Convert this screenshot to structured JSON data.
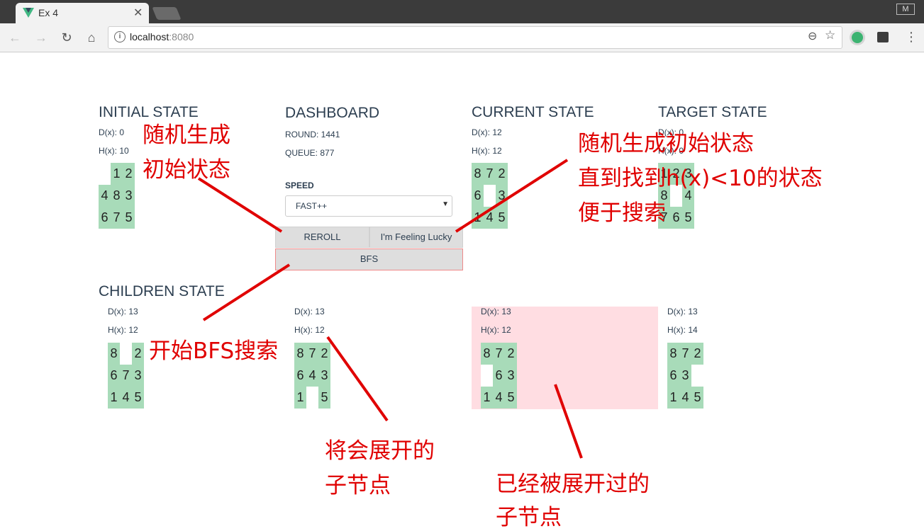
{
  "browser": {
    "tab_title": "Ex 4",
    "tab_close": "✕",
    "profile_letter": "M",
    "url_host": "localhost",
    "url_port": ":8080"
  },
  "initial": {
    "title": "INITIAL STATE",
    "dx": "D(x): 0",
    "hx": "H(x): 10",
    "grid": [
      "",
      "1",
      "2",
      "4",
      "8",
      "3",
      "6",
      "7",
      "5"
    ]
  },
  "dashboard": {
    "title": "DASHBOARD",
    "round": "ROUND: 1441",
    "queue": "QUEUE: 877",
    "speed_label": "SPEED",
    "speed_value": "FAST++",
    "reroll_label": "REROLL",
    "lucky_label": "I'm Feeling Lucky",
    "bfs_label": "BFS"
  },
  "current": {
    "title": "CURRENT STATE",
    "dx": "D(x): 12",
    "hx": "H(x): 12",
    "grid": [
      "8",
      "7",
      "2",
      "6",
      "",
      "3",
      "1",
      "4",
      "5"
    ]
  },
  "target": {
    "title": "TARGET STATE",
    "dx": "D(x): 0",
    "hx": "H(x): 0",
    "grid": [
      "1",
      "2",
      "3",
      "8",
      "",
      "4",
      "7",
      "6",
      "5"
    ]
  },
  "children": {
    "title": "CHILDREN STATE",
    "items": [
      {
        "dx": "D(x): 13",
        "hx": "H(x): 12",
        "grid": [
          "8",
          "",
          "2",
          "6",
          "7",
          "3",
          "1",
          "4",
          "5"
        ],
        "visited": false
      },
      {
        "dx": "D(x): 13",
        "hx": "H(x): 12",
        "grid": [
          "8",
          "7",
          "2",
          "6",
          "4",
          "3",
          "1",
          "",
          "5"
        ],
        "visited": false
      },
      {
        "dx": "D(x): 13",
        "hx": "H(x): 12",
        "grid": [
          "8",
          "7",
          "2",
          "",
          "6",
          "3",
          "1",
          "4",
          "5"
        ],
        "visited": true
      },
      {
        "dx": "D(x): 13",
        "hx": "H(x): 14",
        "grid": [
          "8",
          "7",
          "2",
          "6",
          "3",
          "",
          "1",
          "4",
          "5"
        ],
        "visited": false
      }
    ]
  },
  "annotations": {
    "random_initial": [
      "随机生成",
      "初始状态"
    ],
    "lucky": [
      "随机生成初始状态",
      "直到找到h(x)<10的状态",
      "便于搜索"
    ],
    "bfs": "开始BFS搜索",
    "to_expand": [
      "将会展开的",
      "子节点"
    ],
    "expanded": [
      "已经被展开过的",
      "子节点"
    ]
  },
  "colors": {
    "tile": "#a8dbb9",
    "visited_bg": "#ffdde2",
    "annotation": "#e00000"
  }
}
